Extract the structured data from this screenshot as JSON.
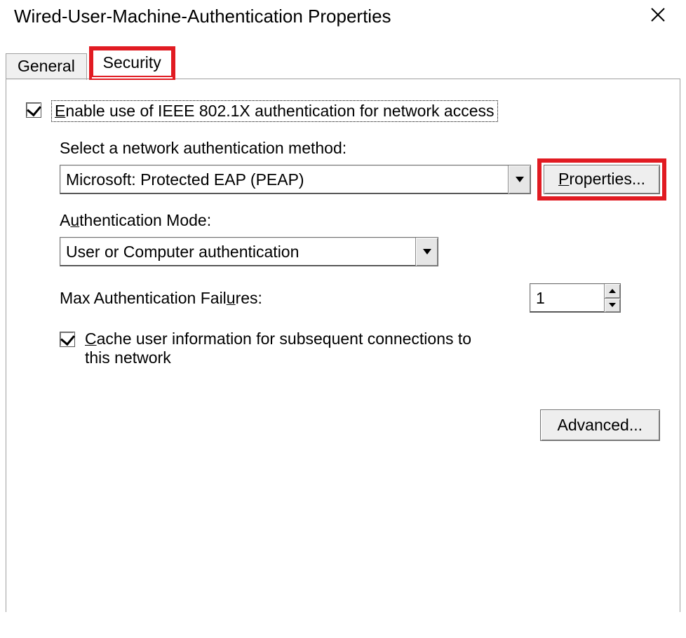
{
  "window": {
    "title": "Wired-User-Machine-Authentication Properties"
  },
  "tabs": {
    "general": "General",
    "security": "Security"
  },
  "security": {
    "enable_8021x_prefix": "E",
    "enable_8021x_rest": "nable use of IEEE 802.1X authentication for network access",
    "enable_8021x_checked": true,
    "auth_method_label": "Select a network authentication method:",
    "auth_method_value": "Microsoft: Protected EAP (PEAP)",
    "properties_btn_prefix": "P",
    "properties_btn_rest": "roperties...",
    "auth_mode_label_pre": "A",
    "auth_mode_label_mid": "u",
    "auth_mode_label_rest": "thentication Mode:",
    "auth_mode_value": "User or Computer authentication",
    "max_failures_label_pre": "Max Authentication Fail",
    "max_failures_label_mid": "u",
    "max_failures_label_rest": "res:",
    "max_failures_value": "1",
    "cache_checked": true,
    "cache_prefix": "C",
    "cache_rest": "ache user information for subsequent connections to this network",
    "advanced_btn": "Advanced..."
  }
}
